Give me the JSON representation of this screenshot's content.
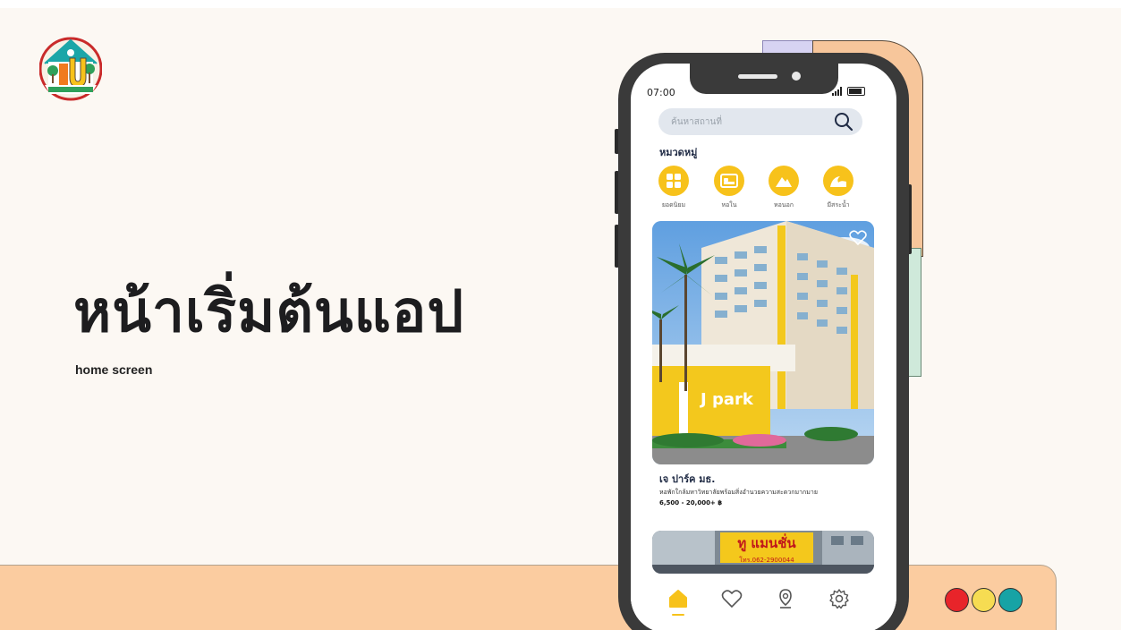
{
  "slide": {
    "title": "หน้าเริ่มต้นแอป",
    "subtitle": "home screen"
  },
  "logo": {
    "icon": "house-u-logo-icon"
  },
  "colors": {
    "accent": "#f7c21b",
    "band": "#fbcca0",
    "dot_red": "#e8242a",
    "dot_yellow": "#f6dc52",
    "dot_teal": "#17a3a5"
  },
  "phone": {
    "status": {
      "time": "07:00"
    },
    "search": {
      "placeholder": "ค้นหาสถานที่"
    },
    "categories_title": "หมวดหมู่",
    "categories": [
      {
        "label": "ยอดนิยม",
        "icon": "grid-icon"
      },
      {
        "label": "หอใน",
        "icon": "bed-icon"
      },
      {
        "label": "หอนอก",
        "icon": "mountain-icon"
      },
      {
        "label": "มีสระน้ำ",
        "icon": "wave-icon"
      }
    ],
    "listing": {
      "name": "เจ ปาร์ค มธ.",
      "description": "หอพักใกล้มหาวิทยาลัยพร้อมสิ่งอำนวยความสะดวกมากมาย",
      "price": "6,500 - 20,000+ ฿",
      "sign_text": "J park"
    },
    "listing2": {
      "sign_text": "ทู แมนชั่น",
      "sign_phone": "โทร.062-2900044"
    },
    "tabs": [
      {
        "name": "home",
        "icon": "home-icon"
      },
      {
        "name": "favorites",
        "icon": "heart-icon"
      },
      {
        "name": "map",
        "icon": "map-pin-icon"
      },
      {
        "name": "settings",
        "icon": "gear-icon"
      }
    ]
  }
}
